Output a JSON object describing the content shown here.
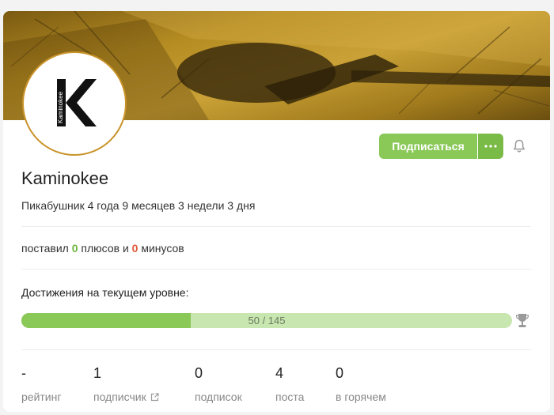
{
  "profile": {
    "username": "Kaminokee",
    "tenure": "Пикабушник 4 года 9 месяцев 3 недели 3 дня",
    "logo_text": "Kaminokee",
    "logo_letter": "K"
  },
  "actions": {
    "subscribe_label": "Подписаться",
    "more_icon": "ellipsis-icon",
    "bell_icon": "bell-icon"
  },
  "votes": {
    "prefix": "поставил",
    "plus_count": "0",
    "plus_label": "плюсов и",
    "minus_count": "0",
    "minus_label": "минусов"
  },
  "achievements": {
    "title": "Достижения на текущем уровне:",
    "progress_text": "50 / 145",
    "current": 50,
    "total": 145,
    "icon": "trophy-icon"
  },
  "stats": [
    {
      "value": "-",
      "label": "рейтинг"
    },
    {
      "value": "1",
      "label": "подписчик",
      "icon": "external-link-icon"
    },
    {
      "value": "0",
      "label": "подписок"
    },
    {
      "value": "4",
      "label": "поста"
    },
    {
      "value": "0",
      "label": "в горячем"
    }
  ],
  "colors": {
    "accent_green": "#8ac858",
    "plus_green": "#6fb63f",
    "minus_red": "#e05a3a",
    "avatar_border": "#c9932a"
  }
}
